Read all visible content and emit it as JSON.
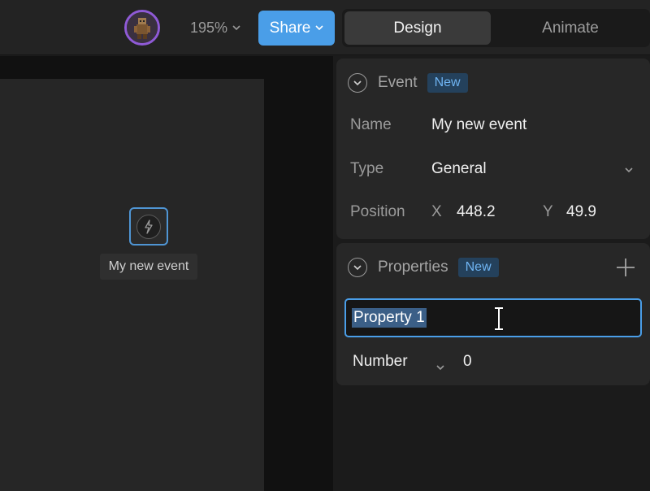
{
  "toolbar": {
    "zoom": "195%",
    "share_label": "Share",
    "tabs": [
      {
        "label": "Design",
        "active": true
      },
      {
        "label": "Animate",
        "active": false
      }
    ]
  },
  "canvas": {
    "event_node_label": "My new event"
  },
  "event_section": {
    "title": "Event",
    "badge": "New",
    "name_label": "Name",
    "name_value": "My new event",
    "type_label": "Type",
    "type_value": "General",
    "position_label": "Position",
    "x_label": "X",
    "x_value": "448.2",
    "y_label": "Y",
    "y_value": "49.9"
  },
  "properties_section": {
    "title": "Properties",
    "badge": "New",
    "property_name": "Property 1",
    "property_type": "Number",
    "property_value": "0"
  },
  "colors": {
    "accent": "#4a9ee8",
    "avatar_ring": "#8f5ad6",
    "badge_text": "#6fb4f2",
    "badge_bg": "#24415c"
  },
  "icons": [
    "avatar-icon",
    "chevron-down-icon",
    "collapse-icon",
    "plus-icon",
    "lightning-icon",
    "text-cursor-icon"
  ]
}
